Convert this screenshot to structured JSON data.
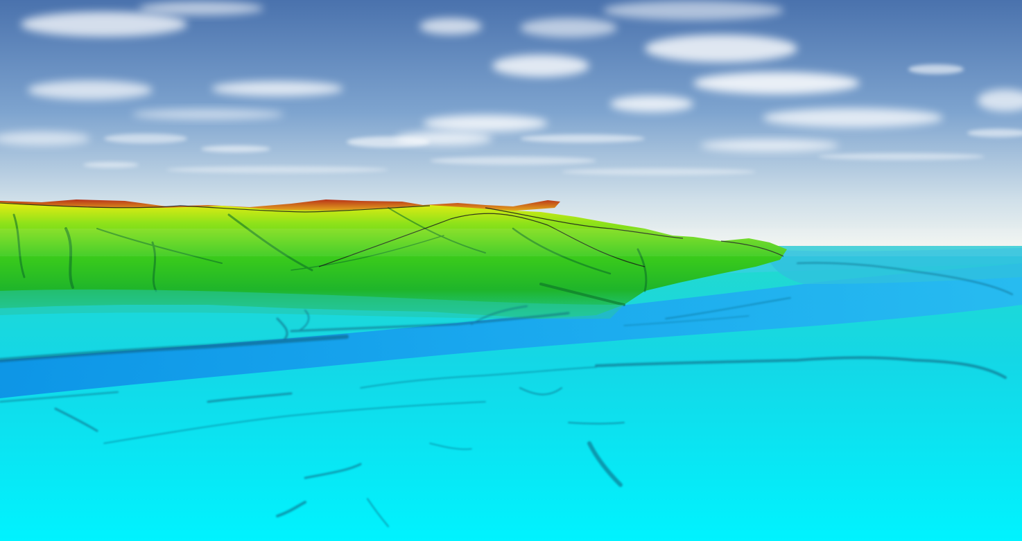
{
  "scene": {
    "type": "3d-terrain-elevation-view",
    "colors": {
      "sky_top": "#4a72ad",
      "sky_mid": "#7ea4cf",
      "sky_horizon": "#eef3f2",
      "cloud": "#ffffff",
      "elev_high": "#b8341a",
      "elev_upper": "#d98a1c",
      "elev_mid_high": "#e6ea14",
      "elev_mid": "#5fd81a",
      "elev_mid_low": "#22b61c",
      "elev_low": "#1ee0c4",
      "elev_lowest": "#00f2ff",
      "river": "#1d8ff2",
      "ridgeline": "#1a1a1a"
    }
  }
}
